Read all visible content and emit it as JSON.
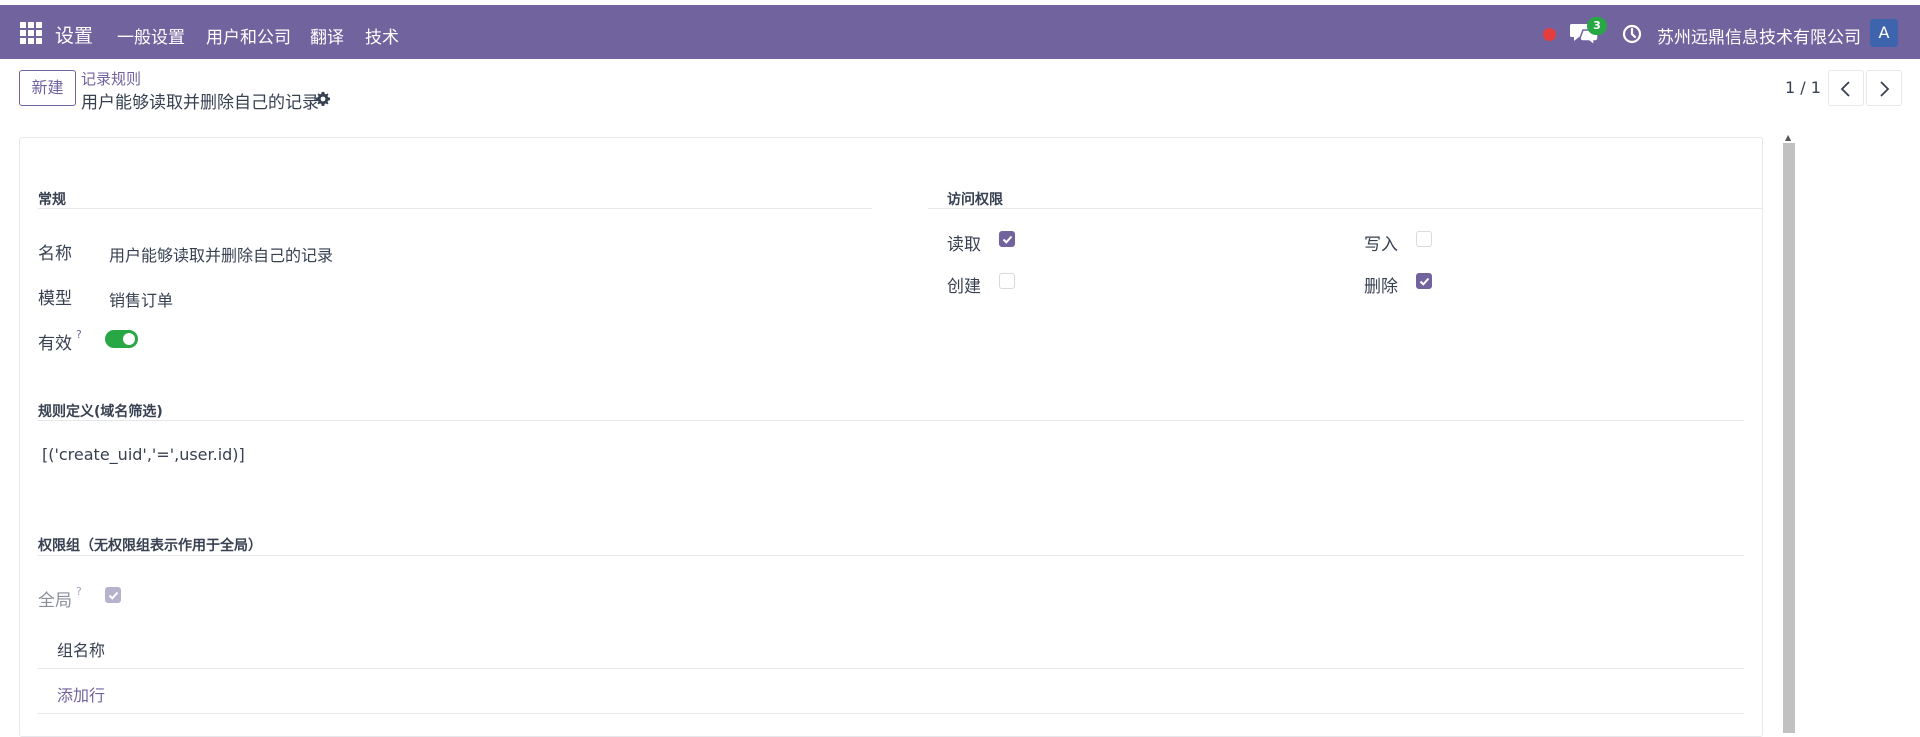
{
  "navbar": {
    "app_title": "设置",
    "menu": [
      "一般设置",
      "用户和公司",
      "翻译",
      "技术"
    ],
    "chat_count": "3",
    "company": "苏州远鼎信息技术有限公司",
    "avatar_letter": "A"
  },
  "control_panel": {
    "new_button": "新建",
    "breadcrumb": "记录规则",
    "record_title": "用户能够读取并删除自己的记录",
    "pager": "1 / 1"
  },
  "form": {
    "general": {
      "title": "常规",
      "name_label": "名称",
      "name_value": "用户能够读取并删除自己的记录",
      "model_label": "模型",
      "model_value": "销售订单",
      "active_label": "有效",
      "active_help": "?",
      "active": true
    },
    "access": {
      "title": "访问权限",
      "read_label": "读取",
      "read": true,
      "write_label": "写入",
      "write": false,
      "create_label": "创建",
      "create": false,
      "unlink_label": "删除",
      "unlink": true
    },
    "domain": {
      "title": "规则定义(域名筛选)",
      "value": "[('create_uid','=',user.id)]"
    },
    "groups": {
      "title": "权限组（无权限组表示作用于全局）",
      "global_label": "全局",
      "global_help": "?",
      "global": true,
      "column_header": "组名称",
      "add_line": "添加行"
    }
  },
  "colors": {
    "brand": "#71639e",
    "toggle_on": "#28a745",
    "status_dot": "#e43d3d",
    "avatar_bg": "#3e64ad"
  },
  "icons": [
    "apps-grid-icon",
    "status-dot-icon",
    "chat-icon",
    "clock-icon",
    "gear-icon",
    "chevron-left-icon",
    "chevron-right-icon",
    "check-icon"
  ]
}
